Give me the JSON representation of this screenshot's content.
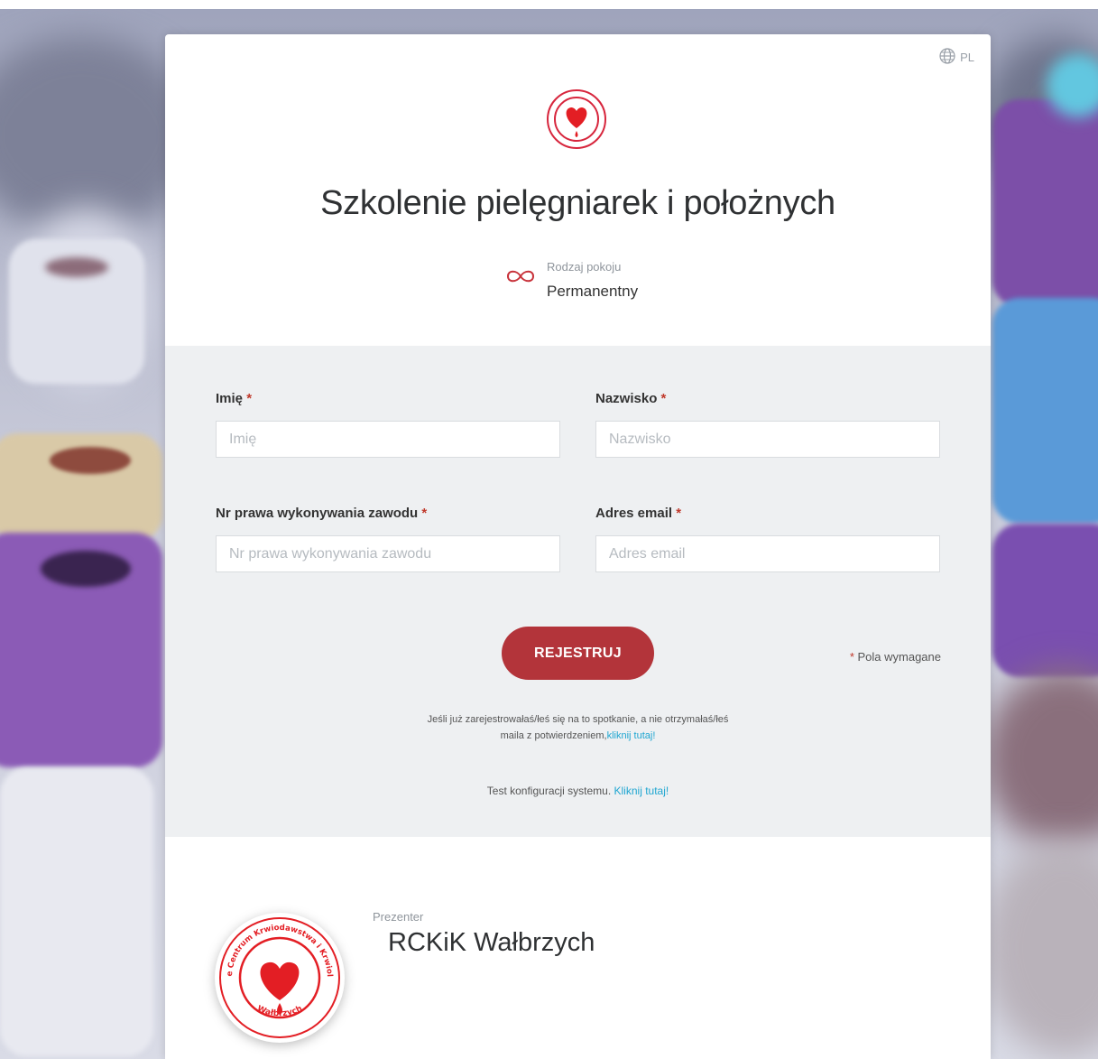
{
  "language": {
    "code": "PL",
    "icon": "globe-icon"
  },
  "meeting": {
    "title": "Szkolenie pielęgniarek i położnych",
    "room_type_label": "Rodzaj pokoju",
    "room_type_value": "Permanentny",
    "room_type_icon": "infinity-icon"
  },
  "form": {
    "first_name": {
      "label": "Imię",
      "placeholder": "Imię"
    },
    "last_name": {
      "label": "Nazwisko",
      "placeholder": "Nazwisko"
    },
    "license": {
      "label": "Nr prawa wykonywania zawodu",
      "placeholder": "Nr prawa wykonywania zawodu"
    },
    "email": {
      "label": "Adres email",
      "placeholder": "Adres email"
    },
    "required_mark": "*",
    "submit_label": "REJESTRUJ",
    "required_note": "Pola wymagane"
  },
  "info": {
    "already_registered_text": "Jeśli już zarejestrowałaś/łeś się na to spotkanie, a nie otrzymałaś/łeś maila z potwierdzeniem,",
    "already_registered_link": "kliknij tutaj!",
    "system_test_text": "Test konfiguracji systemu.",
    "system_test_link": "Kliknij tutaj!"
  },
  "presenter": {
    "label": "Prezenter",
    "name": "RCKiK Wałbrzych",
    "logo_text_top": "Regionalne Centrum Krwiodawstwa i Krwiolecznictwa",
    "logo_text_bottom": "Wałbrzych"
  },
  "colors": {
    "accent": "#b3343a",
    "link": "#1fa6d1",
    "required": "#c0392b",
    "form_band": "#eef0f2"
  }
}
